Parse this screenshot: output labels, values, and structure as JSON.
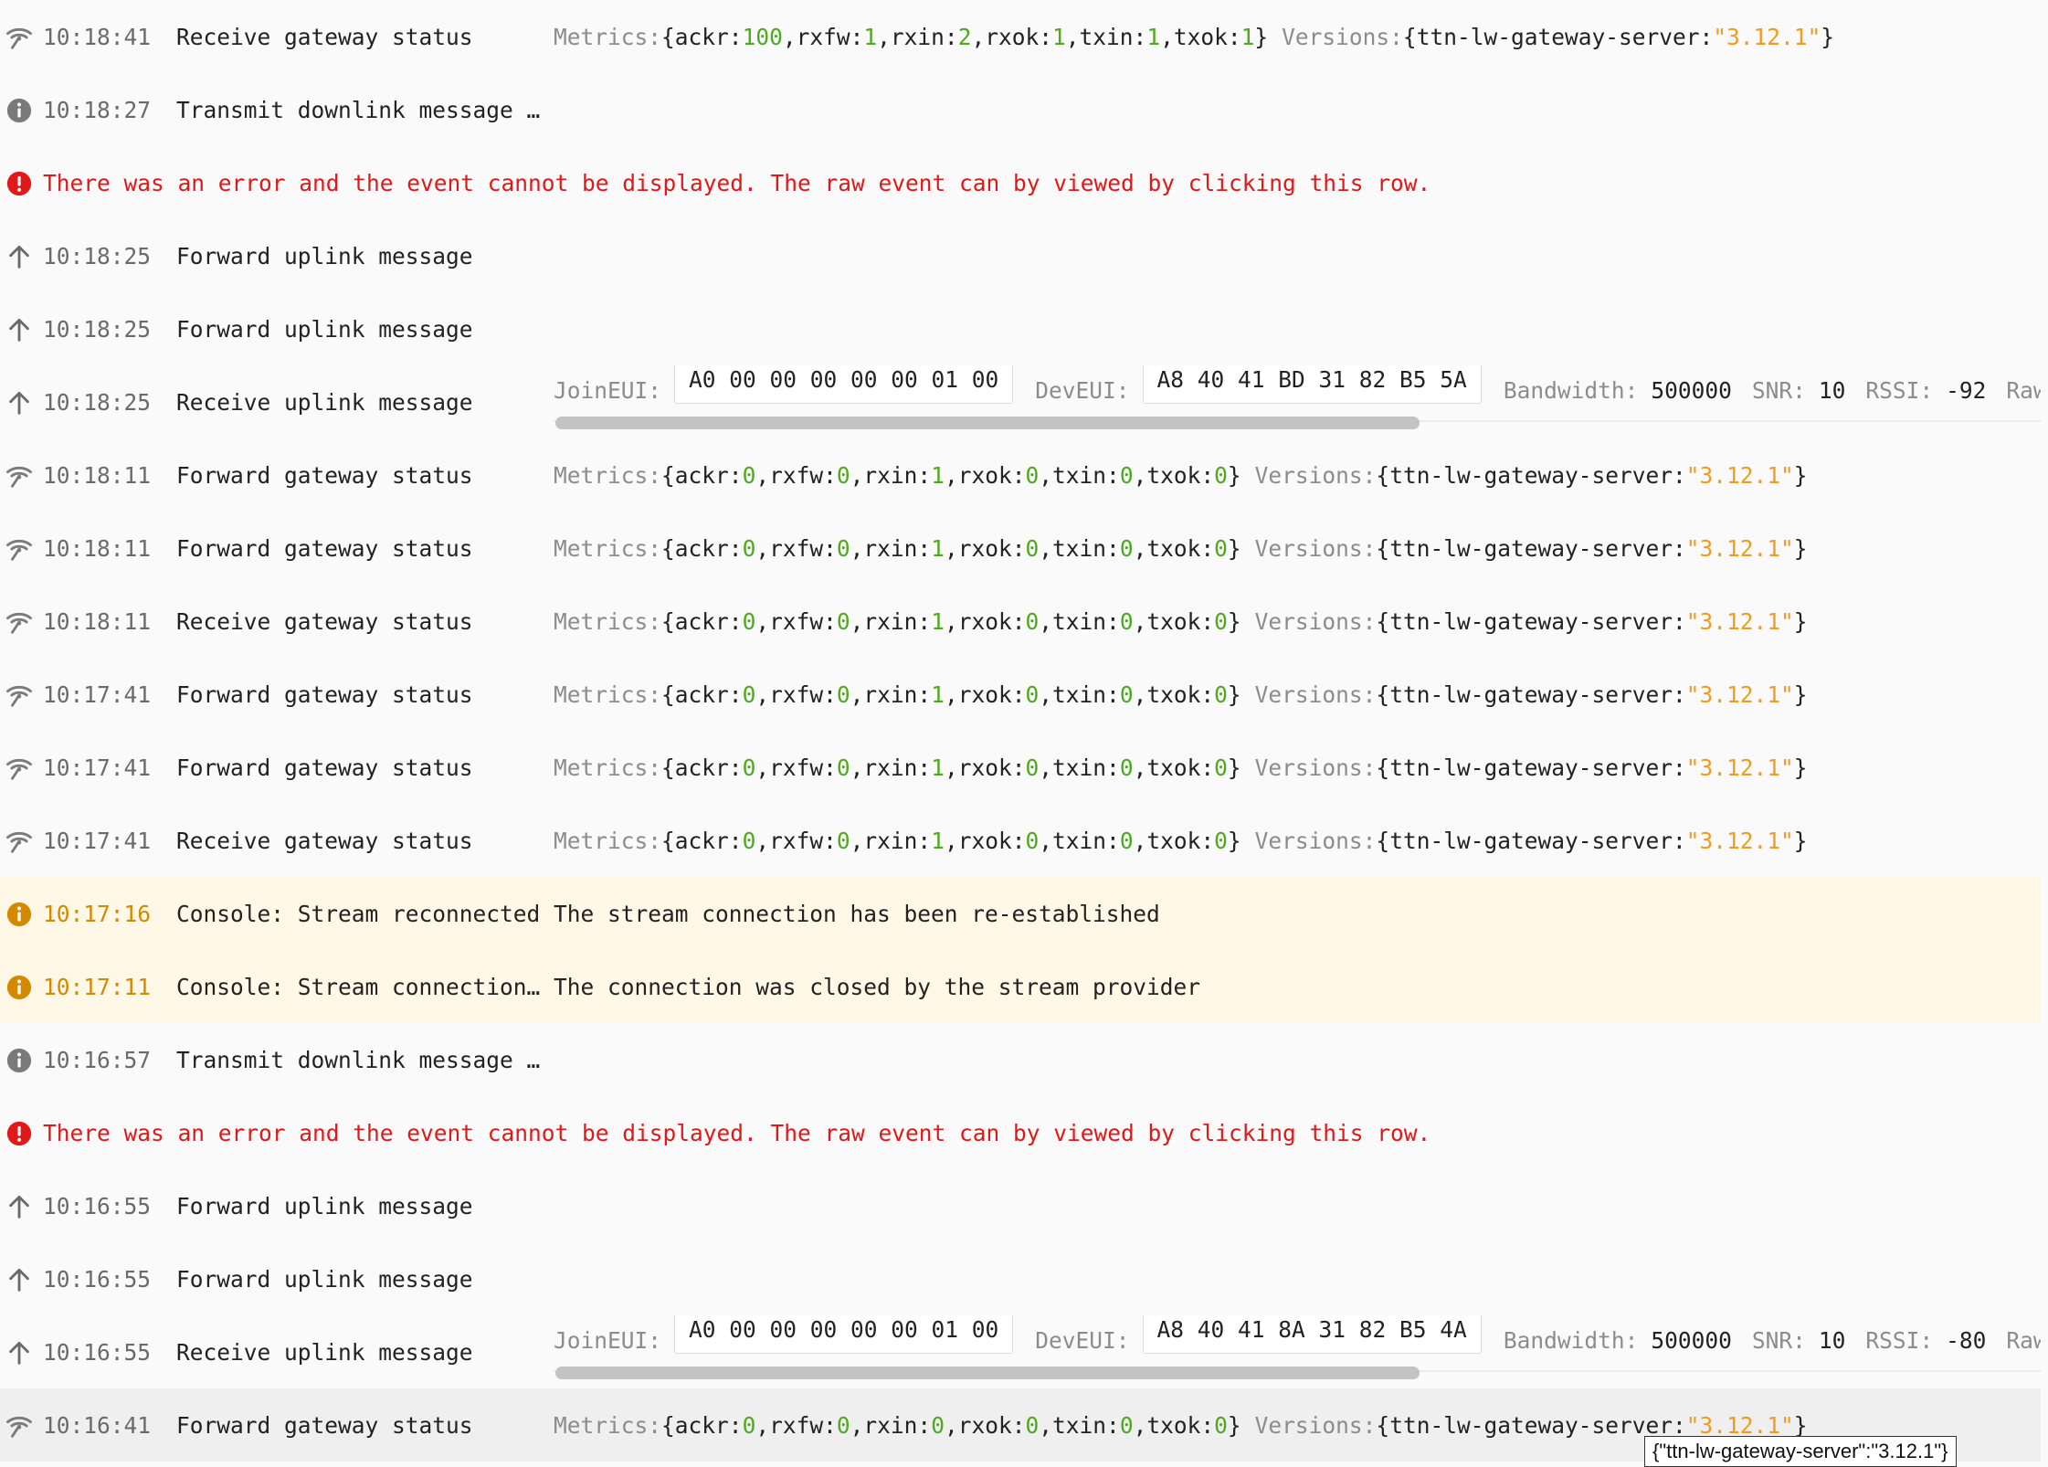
{
  "sep": ", ",
  "open_brace": "{ ",
  "close_brace": " }",
  "colon": ": ",
  "labels": {
    "metrics": "Metrics: ",
    "versions": "Versions: ",
    "gs_key": "ttn-lw-gateway-server",
    "joineui": "JoinEUI:",
    "deveui": "DevEUI:",
    "bandwidth": "Bandwidth:",
    "snr": "SNR:",
    "rssi": "RSSI:",
    "raw_payload": "Raw payloa"
  },
  "colors": {
    "error": "#e01818",
    "warning": "#d38a00",
    "number": "#4fa81f",
    "string": "#ef9c20",
    "warn_row_bg": "#fff8e6"
  },
  "tooltip": "{\"ttn-lw-gateway-server\":\"3.12.1\"}",
  "events": [
    {
      "kind": "status",
      "icon": "wifi-icon",
      "time": "10:18:41",
      "type": "Receive gateway status",
      "metrics": [
        [
          "ackr",
          "100"
        ],
        [
          "rxfw",
          "1"
        ],
        [
          "rxin",
          "2"
        ],
        [
          "rxok",
          "1"
        ],
        [
          "txin",
          "1"
        ],
        [
          "txok",
          "1"
        ]
      ],
      "version": "\"3.12.1\""
    },
    {
      "kind": "info",
      "icon": "info-icon",
      "time": "10:18:27",
      "type": "Transmit downlink message …"
    },
    {
      "kind": "error",
      "icon": "error-icon",
      "text": "There was an error and the event cannot be displayed. The raw event can by viewed by clicking this row."
    },
    {
      "kind": "info",
      "icon": "arrow-up-icon",
      "time": "10:18:25",
      "type": "Forward uplink message"
    },
    {
      "kind": "info",
      "icon": "arrow-up-icon",
      "time": "10:18:25",
      "type": "Forward uplink message"
    },
    {
      "kind": "uplink",
      "icon": "arrow-up-icon",
      "time": "10:18:25",
      "type": "Receive uplink message",
      "joineui": "A0 00 00 00 00 00 01 00",
      "deveui": "A8 40 41 BD 31 82 B5 5A",
      "bandwidth": "500000",
      "snr": "10",
      "rssi": "-92"
    },
    {
      "kind": "status",
      "icon": "wifi-icon",
      "time": "10:18:11",
      "type": "Forward gateway status",
      "metrics": [
        [
          "ackr",
          "0"
        ],
        [
          "rxfw",
          "0"
        ],
        [
          "rxin",
          "1"
        ],
        [
          "rxok",
          "0"
        ],
        [
          "txin",
          "0"
        ],
        [
          "txok",
          "0"
        ]
      ],
      "version": "\"3.12.1\""
    },
    {
      "kind": "status",
      "icon": "wifi-icon",
      "time": "10:18:11",
      "type": "Forward gateway status",
      "metrics": [
        [
          "ackr",
          "0"
        ],
        [
          "rxfw",
          "0"
        ],
        [
          "rxin",
          "1"
        ],
        [
          "rxok",
          "0"
        ],
        [
          "txin",
          "0"
        ],
        [
          "txok",
          "0"
        ]
      ],
      "version": "\"3.12.1\""
    },
    {
      "kind": "status",
      "icon": "wifi-icon",
      "time": "10:18:11",
      "type": "Receive gateway status",
      "metrics": [
        [
          "ackr",
          "0"
        ],
        [
          "rxfw",
          "0"
        ],
        [
          "rxin",
          "1"
        ],
        [
          "rxok",
          "0"
        ],
        [
          "txin",
          "0"
        ],
        [
          "txok",
          "0"
        ]
      ],
      "version": "\"3.12.1\""
    },
    {
      "kind": "status",
      "icon": "wifi-icon",
      "time": "10:17:41",
      "type": "Forward gateway status",
      "metrics": [
        [
          "ackr",
          "0"
        ],
        [
          "rxfw",
          "0"
        ],
        [
          "rxin",
          "1"
        ],
        [
          "rxok",
          "0"
        ],
        [
          "txin",
          "0"
        ],
        [
          "txok",
          "0"
        ]
      ],
      "version": "\"3.12.1\""
    },
    {
      "kind": "status",
      "icon": "wifi-icon",
      "time": "10:17:41",
      "type": "Forward gateway status",
      "metrics": [
        [
          "ackr",
          "0"
        ],
        [
          "rxfw",
          "0"
        ],
        [
          "rxin",
          "1"
        ],
        [
          "rxok",
          "0"
        ],
        [
          "txin",
          "0"
        ],
        [
          "txok",
          "0"
        ]
      ],
      "version": "\"3.12.1\""
    },
    {
      "kind": "status",
      "icon": "wifi-icon",
      "time": "10:17:41",
      "type": "Receive gateway status",
      "metrics": [
        [
          "ackr",
          "0"
        ],
        [
          "rxfw",
          "0"
        ],
        [
          "rxin",
          "1"
        ],
        [
          "rxok",
          "0"
        ],
        [
          "txin",
          "0"
        ],
        [
          "txok",
          "0"
        ]
      ],
      "version": "\"3.12.1\""
    },
    {
      "kind": "warn",
      "icon": "info-icon",
      "time": "10:17:16",
      "type": "Console: Stream reconnected",
      "message": "The stream connection has been re-established"
    },
    {
      "kind": "warn",
      "icon": "info-icon",
      "time": "10:17:11",
      "type": "Console: Stream connection…",
      "message": "The connection was closed by the stream provider"
    },
    {
      "kind": "info",
      "icon": "info-icon",
      "time": "10:16:57",
      "type": "Transmit downlink message …"
    },
    {
      "kind": "error",
      "icon": "error-icon",
      "text": "There was an error and the event cannot be displayed. The raw event can by viewed by clicking this row."
    },
    {
      "kind": "info",
      "icon": "arrow-up-icon",
      "time": "10:16:55",
      "type": "Forward uplink message"
    },
    {
      "kind": "info",
      "icon": "arrow-up-icon",
      "time": "10:16:55",
      "type": "Forward uplink message"
    },
    {
      "kind": "uplink",
      "icon": "arrow-up-icon",
      "time": "10:16:55",
      "type": "Receive uplink message",
      "joineui": "A0 00 00 00 00 00 01 00",
      "deveui": "A8 40 41 8A 31 82 B5 4A",
      "bandwidth": "500000",
      "snr": "10",
      "rssi": "-80"
    },
    {
      "kind": "status",
      "icon": "wifi-icon",
      "time": "10:16:41",
      "type": "Forward gateway status",
      "hover": true,
      "metrics": [
        [
          "ackr",
          "0"
        ],
        [
          "rxfw",
          "0"
        ],
        [
          "rxin",
          "0"
        ],
        [
          "rxok",
          "0"
        ],
        [
          "txin",
          "0"
        ],
        [
          "txok",
          "0"
        ]
      ],
      "version": "\"3.12.1\""
    }
  ]
}
